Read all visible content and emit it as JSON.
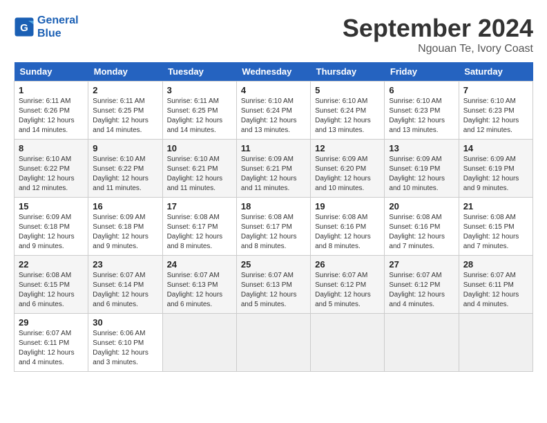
{
  "logo": {
    "line1": "General",
    "line2": "Blue"
  },
  "title": "September 2024",
  "location": "Ngouan Te, Ivory Coast",
  "headers": [
    "Sunday",
    "Monday",
    "Tuesday",
    "Wednesday",
    "Thursday",
    "Friday",
    "Saturday"
  ],
  "weeks": [
    [
      {
        "day": "1",
        "sunrise": "6:11 AM",
        "sunset": "6:26 PM",
        "daylight": "12 hours and 14 minutes."
      },
      {
        "day": "2",
        "sunrise": "6:11 AM",
        "sunset": "6:25 PM",
        "daylight": "12 hours and 14 minutes."
      },
      {
        "day": "3",
        "sunrise": "6:11 AM",
        "sunset": "6:25 PM",
        "daylight": "12 hours and 14 minutes."
      },
      {
        "day": "4",
        "sunrise": "6:10 AM",
        "sunset": "6:24 PM",
        "daylight": "12 hours and 13 minutes."
      },
      {
        "day": "5",
        "sunrise": "6:10 AM",
        "sunset": "6:24 PM",
        "daylight": "12 hours and 13 minutes."
      },
      {
        "day": "6",
        "sunrise": "6:10 AM",
        "sunset": "6:23 PM",
        "daylight": "12 hours and 13 minutes."
      },
      {
        "day": "7",
        "sunrise": "6:10 AM",
        "sunset": "6:23 PM",
        "daylight": "12 hours and 12 minutes."
      }
    ],
    [
      {
        "day": "8",
        "sunrise": "6:10 AM",
        "sunset": "6:22 PM",
        "daylight": "12 hours and 12 minutes."
      },
      {
        "day": "9",
        "sunrise": "6:10 AM",
        "sunset": "6:22 PM",
        "daylight": "12 hours and 11 minutes."
      },
      {
        "day": "10",
        "sunrise": "6:10 AM",
        "sunset": "6:21 PM",
        "daylight": "12 hours and 11 minutes."
      },
      {
        "day": "11",
        "sunrise": "6:09 AM",
        "sunset": "6:21 PM",
        "daylight": "12 hours and 11 minutes."
      },
      {
        "day": "12",
        "sunrise": "6:09 AM",
        "sunset": "6:20 PM",
        "daylight": "12 hours and 10 minutes."
      },
      {
        "day": "13",
        "sunrise": "6:09 AM",
        "sunset": "6:19 PM",
        "daylight": "12 hours and 10 minutes."
      },
      {
        "day": "14",
        "sunrise": "6:09 AM",
        "sunset": "6:19 PM",
        "daylight": "12 hours and 9 minutes."
      }
    ],
    [
      {
        "day": "15",
        "sunrise": "6:09 AM",
        "sunset": "6:18 PM",
        "daylight": "12 hours and 9 minutes."
      },
      {
        "day": "16",
        "sunrise": "6:09 AM",
        "sunset": "6:18 PM",
        "daylight": "12 hours and 9 minutes."
      },
      {
        "day": "17",
        "sunrise": "6:08 AM",
        "sunset": "6:17 PM",
        "daylight": "12 hours and 8 minutes."
      },
      {
        "day": "18",
        "sunrise": "6:08 AM",
        "sunset": "6:17 PM",
        "daylight": "12 hours and 8 minutes."
      },
      {
        "day": "19",
        "sunrise": "6:08 AM",
        "sunset": "6:16 PM",
        "daylight": "12 hours and 8 minutes."
      },
      {
        "day": "20",
        "sunrise": "6:08 AM",
        "sunset": "6:16 PM",
        "daylight": "12 hours and 7 minutes."
      },
      {
        "day": "21",
        "sunrise": "6:08 AM",
        "sunset": "6:15 PM",
        "daylight": "12 hours and 7 minutes."
      }
    ],
    [
      {
        "day": "22",
        "sunrise": "6:08 AM",
        "sunset": "6:15 PM",
        "daylight": "12 hours and 6 minutes."
      },
      {
        "day": "23",
        "sunrise": "6:07 AM",
        "sunset": "6:14 PM",
        "daylight": "12 hours and 6 minutes."
      },
      {
        "day": "24",
        "sunrise": "6:07 AM",
        "sunset": "6:13 PM",
        "daylight": "12 hours and 6 minutes."
      },
      {
        "day": "25",
        "sunrise": "6:07 AM",
        "sunset": "6:13 PM",
        "daylight": "12 hours and 5 minutes."
      },
      {
        "day": "26",
        "sunrise": "6:07 AM",
        "sunset": "6:12 PM",
        "daylight": "12 hours and 5 minutes."
      },
      {
        "day": "27",
        "sunrise": "6:07 AM",
        "sunset": "6:12 PM",
        "daylight": "12 hours and 4 minutes."
      },
      {
        "day": "28",
        "sunrise": "6:07 AM",
        "sunset": "6:11 PM",
        "daylight": "12 hours and 4 minutes."
      }
    ],
    [
      {
        "day": "29",
        "sunrise": "6:07 AM",
        "sunset": "6:11 PM",
        "daylight": "12 hours and 4 minutes."
      },
      {
        "day": "30",
        "sunrise": "6:06 AM",
        "sunset": "6:10 PM",
        "daylight": "12 hours and 3 minutes."
      },
      null,
      null,
      null,
      null,
      null
    ]
  ],
  "labels": {
    "sunrise": "Sunrise:",
    "sunset": "Sunset:",
    "daylight": "Daylight:"
  }
}
